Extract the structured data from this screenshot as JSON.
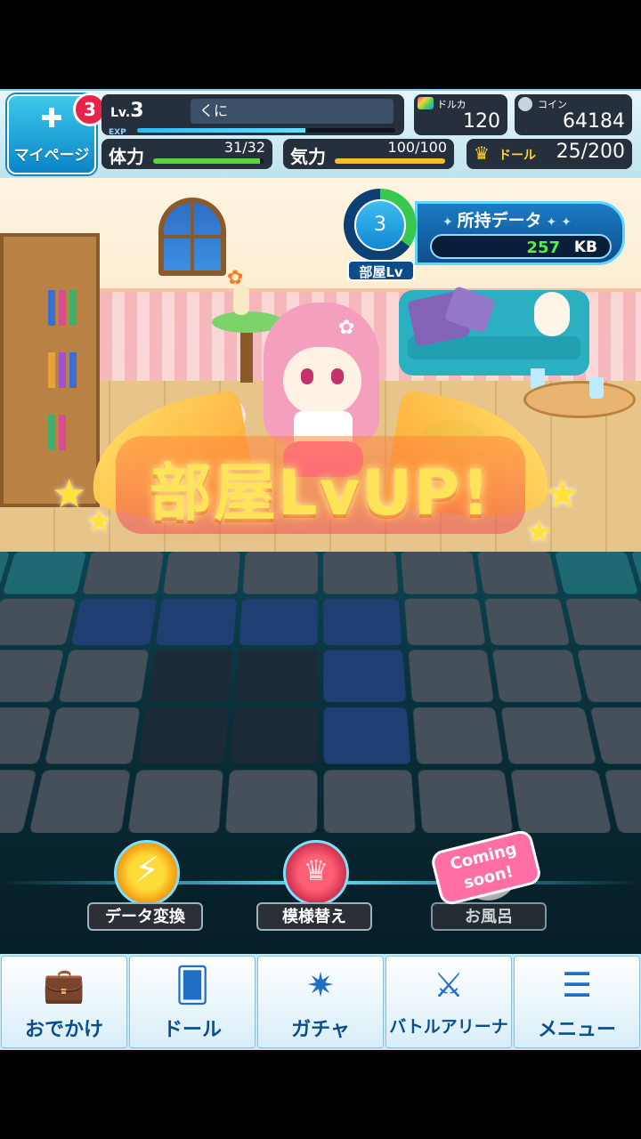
{
  "header": {
    "mypage_label": "マイページ",
    "notification_count": "3",
    "level_prefix": "Lv.",
    "level": "3",
    "exp_label": "EXP",
    "player_name": "くに",
    "exp_progress": 0.65,
    "dolka_label": "ドルカ",
    "dolka_value": "120",
    "coin_label": "コイン",
    "coin_value": "64184",
    "stamina_label": "体力",
    "stamina_value": "31/32",
    "stamina_progress": 0.97,
    "spirit_label": "気力",
    "spirit_value": "100/100",
    "spirit_progress": 1.0,
    "doll_label": "ドール",
    "doll_value": "25/200"
  },
  "room": {
    "level": "3",
    "level_label": "部屋Lv",
    "level_progress": 0.35,
    "data_title": "所持データ",
    "data_value": "257",
    "data_unit": "KB",
    "levelup_text": "部屋LvUP!"
  },
  "actions": {
    "data_convert": "データ変換",
    "pattern_change": "模様替え",
    "bath": "お風呂",
    "coming_soon": "Coming soon!"
  },
  "nav": [
    {
      "label": "おでかけ",
      "icon": "briefcase-icon"
    },
    {
      "label": "ドール",
      "icon": "cards-icon"
    },
    {
      "label": "ガチャ",
      "icon": "gacha-icon"
    },
    {
      "label": "バトルアリーナ",
      "icon": "swords-icon"
    },
    {
      "label": "メニュー",
      "icon": "menu-icon"
    }
  ],
  "colors": {
    "accent": "#1088d4",
    "data_value": "#54ef4d",
    "stamina_bar": "#5fd33c",
    "spirit_bar": "#f4c21e"
  }
}
